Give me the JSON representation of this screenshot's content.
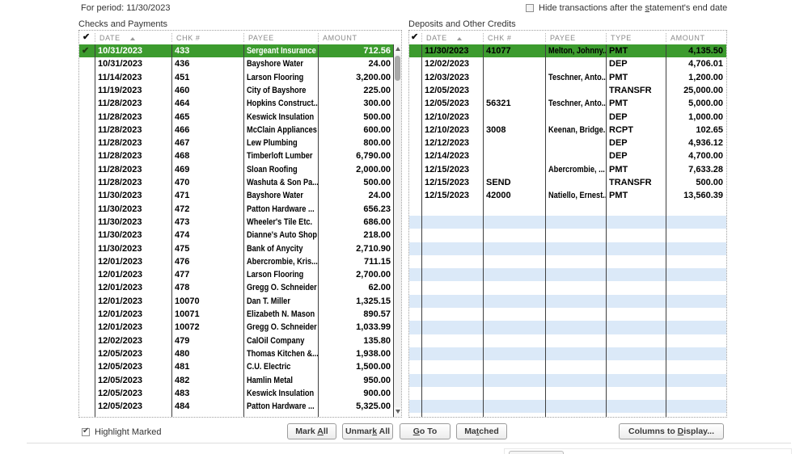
{
  "period": {
    "label": "For period:",
    "value": "11/30/2023"
  },
  "hide_checkbox": {
    "pre": "Hide transactions after the ",
    "underline": "s",
    "post": "tatement's end date",
    "checked": false
  },
  "highlight_checkbox": {
    "label": "Highlight Marked",
    "checked": true
  },
  "buttons": {
    "mark_all": {
      "pre": "Mark ",
      "underline": "A",
      "post": "ll"
    },
    "unmark_all": {
      "pre": "Unmar",
      "underline": "k",
      "post": " All"
    },
    "go_to": {
      "pre": "",
      "underline": "G",
      "post": "o To"
    },
    "matched": {
      "pre": "Ma",
      "underline": "t",
      "post": "ched"
    },
    "columns_to_display": {
      "pre": "Columns to ",
      "underline": "D",
      "post": "isplay..."
    }
  },
  "checks_table": {
    "title": "Checks and Payments",
    "headers": {
      "check": "✔",
      "date": "DATE",
      "chk": "CHK #",
      "payee": "PAYEE",
      "amount": "AMOUNT"
    },
    "rows": [
      {
        "date": "10/31/2023",
        "chk": "433",
        "payee": "Sergeant Insurance",
        "amount": "712.56",
        "checked": true,
        "selected": true
      },
      {
        "date": "10/31/2023",
        "chk": "436",
        "payee": "Bayshore Water",
        "amount": "24.00"
      },
      {
        "date": "11/14/2023",
        "chk": "451",
        "payee": "Larson Flooring",
        "amount": "3,200.00"
      },
      {
        "date": "11/19/2023",
        "chk": "460",
        "payee": "City of Bayshore",
        "amount": "225.00"
      },
      {
        "date": "11/28/2023",
        "chk": "464",
        "payee": "Hopkins Construct...",
        "amount": "300.00"
      },
      {
        "date": "11/28/2023",
        "chk": "465",
        "payee": "Keswick Insulation",
        "amount": "500.00"
      },
      {
        "date": "11/28/2023",
        "chk": "466",
        "payee": "McClain Appliances",
        "amount": "600.00"
      },
      {
        "date": "11/28/2023",
        "chk": "467",
        "payee": "Lew Plumbing",
        "amount": "800.00"
      },
      {
        "date": "11/28/2023",
        "chk": "468",
        "payee": "Timberloft Lumber",
        "amount": "6,790.00"
      },
      {
        "date": "11/28/2023",
        "chk": "469",
        "payee": "Sloan Roofing",
        "amount": "2,000.00"
      },
      {
        "date": "11/28/2023",
        "chk": "470",
        "payee": "Washuta & Son Pa...",
        "amount": "500.00"
      },
      {
        "date": "11/30/2023",
        "chk": "471",
        "payee": "Bayshore Water",
        "amount": "24.00"
      },
      {
        "date": "11/30/2023",
        "chk": "472",
        "payee": "Patton Hardware ...",
        "amount": "656.23"
      },
      {
        "date": "11/30/2023",
        "chk": "473",
        "payee": "Wheeler's Tile Etc.",
        "amount": "686.00"
      },
      {
        "date": "11/30/2023",
        "chk": "474",
        "payee": "Dianne's Auto Shop",
        "amount": "218.00"
      },
      {
        "date": "11/30/2023",
        "chk": "475",
        "payee": "Bank of Anycity",
        "amount": "2,710.90"
      },
      {
        "date": "12/01/2023",
        "chk": "476",
        "payee": "Abercrombie, Kris...",
        "amount": "711.15"
      },
      {
        "date": "12/01/2023",
        "chk": "477",
        "payee": "Larson Flooring",
        "amount": "2,700.00"
      },
      {
        "date": "12/01/2023",
        "chk": "478",
        "payee": "Gregg O. Schneider",
        "amount": "62.00"
      },
      {
        "date": "12/01/2023",
        "chk": "10070",
        "payee": "Dan T. Miller",
        "amount": "1,325.15"
      },
      {
        "date": "12/01/2023",
        "chk": "10071",
        "payee": "Elizabeth N. Mason",
        "amount": "890.57"
      },
      {
        "date": "12/01/2023",
        "chk": "10072",
        "payee": "Gregg O. Schneider",
        "amount": "1,033.99"
      },
      {
        "date": "12/02/2023",
        "chk": "479",
        "payee": "CalOil Company",
        "amount": "135.80"
      },
      {
        "date": "12/05/2023",
        "chk": "480",
        "payee": "Thomas Kitchen &...",
        "amount": "1,938.00"
      },
      {
        "date": "12/05/2023",
        "chk": "481",
        "payee": "C.U. Electric",
        "amount": "1,500.00"
      },
      {
        "date": "12/05/2023",
        "chk": "482",
        "payee": "Hamlin Metal",
        "amount": "950.00"
      },
      {
        "date": "12/05/2023",
        "chk": "483",
        "payee": "Keswick Insulation",
        "amount": "900.00"
      },
      {
        "date": "12/05/2023",
        "chk": "484",
        "payee": "Patton Hardware ...",
        "amount": "5,325.00"
      }
    ]
  },
  "deposits_table": {
    "title": "Deposits and Other Credits",
    "headers": {
      "check": "✔",
      "date": "DATE",
      "chk": "CHK #",
      "payee": "PAYEE",
      "type": "TYPE",
      "amount": "AMOUNT"
    },
    "rows": [
      {
        "date": "11/30/2023",
        "chk": "41077",
        "payee": "Melton, Johnny...",
        "type": "PMT",
        "amount": "4,135.50",
        "marked": true
      },
      {
        "date": "12/02/2023",
        "chk": "",
        "payee": "",
        "type": "DEP",
        "amount": "4,706.01"
      },
      {
        "date": "12/03/2023",
        "chk": "",
        "payee": "Teschner, Anto...",
        "type": "PMT",
        "amount": "1,200.00"
      },
      {
        "date": "12/05/2023",
        "chk": "",
        "payee": "",
        "type": "TRANSFR",
        "amount": "25,000.00"
      },
      {
        "date": "12/05/2023",
        "chk": "56321",
        "payee": "Teschner, Anto...",
        "type": "PMT",
        "amount": "5,000.00"
      },
      {
        "date": "12/10/2023",
        "chk": "",
        "payee": "",
        "type": "DEP",
        "amount": "1,000.00"
      },
      {
        "date": "12/10/2023",
        "chk": "3008",
        "payee": "Keenan, Bridge...",
        "type": "RCPT",
        "amount": "102.65"
      },
      {
        "date": "12/12/2023",
        "chk": "",
        "payee": "",
        "type": "DEP",
        "amount": "4,936.12"
      },
      {
        "date": "12/14/2023",
        "chk": "",
        "payee": "",
        "type": "DEP",
        "amount": "4,700.00"
      },
      {
        "date": "12/15/2023",
        "chk": "",
        "payee": "Abercrombie, ...",
        "type": "PMT",
        "amount": "7,633.28"
      },
      {
        "date": "12/15/2023",
        "chk": "SEND",
        "payee": "",
        "type": "TRANSFR",
        "amount": "500.00"
      },
      {
        "date": "12/15/2023",
        "chk": "42000",
        "payee": "Natiello, Ernest...",
        "type": "PMT",
        "amount": "13,560.39"
      }
    ],
    "empty_row_count": 16
  },
  "colors": {
    "highlight_green": "#3C9B2E",
    "stripe_blue": "#DBE9F8"
  }
}
